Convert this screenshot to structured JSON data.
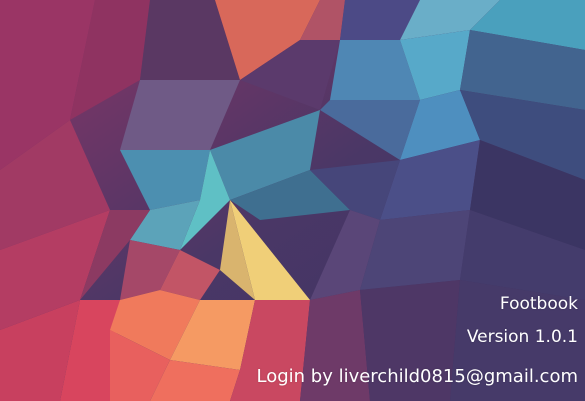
{
  "splash": {
    "app_name": "Footbook",
    "version": "Version 1.0.1",
    "login": "Login by liverchild0815@gmail.com"
  },
  "colors": {
    "text": "#ffffff",
    "background_base": "#3a2f5a",
    "accent_teal": "#5fc6c8",
    "accent_yellow": "#f0cf78",
    "accent_coral": "#f07a5c",
    "accent_magenta": "#c23b63"
  }
}
